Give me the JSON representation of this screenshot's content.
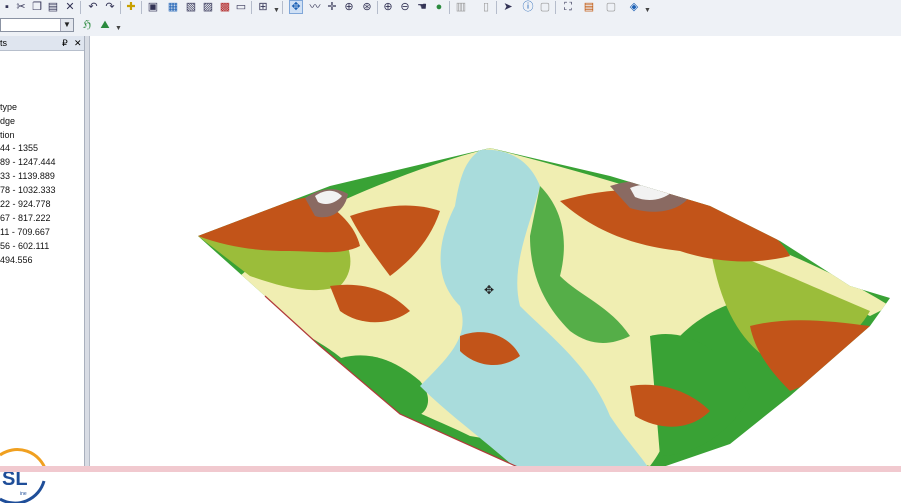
{
  "toc": {
    "title": "ts",
    "pin_icon": "pin-icon",
    "close_icon": "close-icon",
    "items": [
      "type",
      "dge",
      "tion",
      "44 - 1355",
      "89 - 1247.444",
      "33 - 1139.889",
      "78 - 1032.333",
      "22 - 924.778",
      "67 - 817.222",
      "11 - 709.667",
      "56 - 602.111",
      "494.556"
    ]
  },
  "logo": {
    "text": "SL",
    "subtitle": "ine"
  },
  "colors": {
    "water": "#a9dcdc",
    "low": "#f0eeb2",
    "mid": "#39a235",
    "upper": "#9bbd3a",
    "high": "#c25419",
    "peak": "#8a6a62",
    "snow": "#f2f2f2",
    "toolbar": "#eef1f6"
  }
}
